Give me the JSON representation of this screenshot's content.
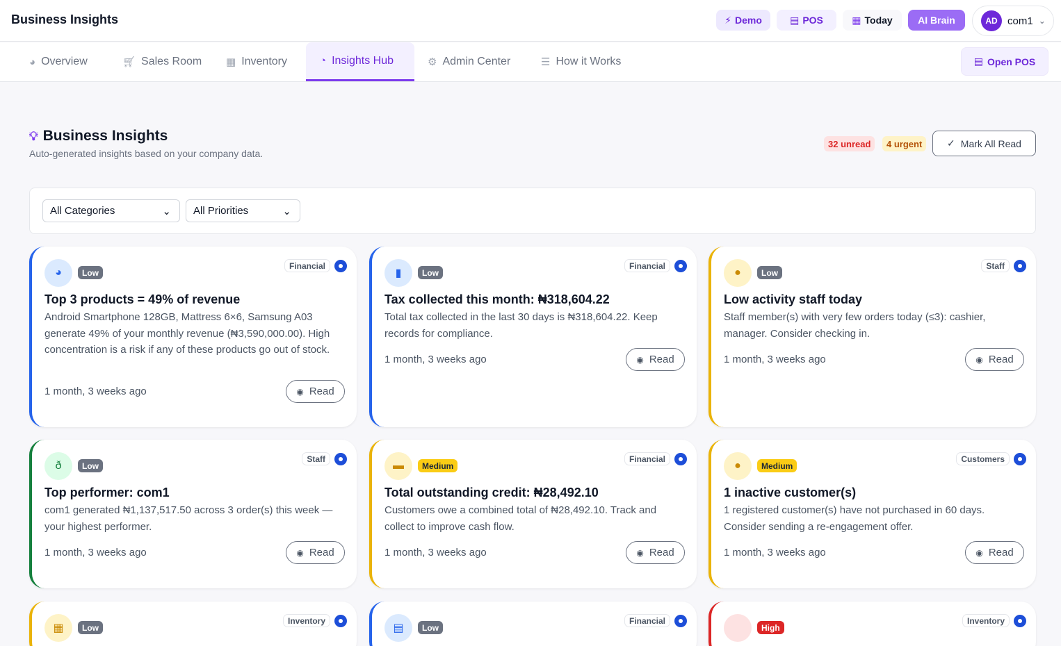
{
  "app": {
    "title": "Business Insights",
    "user_initials": "AD",
    "user_name": "com1"
  },
  "topbar": {
    "demo": "Demo",
    "pos": "POS",
    "today": "Today",
    "ai_brain": "AI Brain"
  },
  "nav": {
    "tabs": [
      {
        "label": "Overview",
        "icon": "dashboard-icon"
      },
      {
        "label": "Sales Room",
        "icon": "cart-icon"
      },
      {
        "label": "Inventory",
        "icon": "boxes-icon"
      },
      {
        "label": "Insights Hub",
        "icon": "pie-chart-icon"
      },
      {
        "label": "Admin Center",
        "icon": "gear-icon"
      },
      {
        "label": "How it Works",
        "icon": "signpost-icon"
      }
    ],
    "active_tab": "Insights Hub",
    "open_pos": "Open POS"
  },
  "header": {
    "title": "Business Insights",
    "subtitle": "Auto-generated insights based on your company data.",
    "unread": "32 unread",
    "urgent": "4 urgent",
    "mark_all": "Mark All Read"
  },
  "filters": {
    "category": "All Categories",
    "priority": "All Priorities"
  },
  "cards": [
    {
      "priority": "Low",
      "category": "Financial",
      "icon": "pie-chart-icon",
      "title": "Top 3 products = 49% of revenue",
      "body": "Android Smartphone 128GB, Mattress 6×6, Samsung A03 generate 49% of your monthly revenue (₦3,590,000.00). High concentration is a risk if any of these products go out of stock.",
      "time": "1 month, 3 weeks ago",
      "read": "Read"
    },
    {
      "priority": "Low",
      "category": "Financial",
      "icon": "invoice-icon",
      "title": "Tax collected this month: ₦318,604.22",
      "body": "Total tax collected in the last 30 days is ₦318,604.22. Keep records for compliance.",
      "time": "1 month, 3 weeks ago",
      "read": "Read"
    },
    {
      "priority": "Low",
      "category": "Staff",
      "icon": "user-icon",
      "title": "Low activity staff today",
      "body": "Staff member(s) with very few orders today (≤3): cashier, manager. Consider checking in.",
      "time": "1 month, 3 weeks ago",
      "read": "Read"
    },
    {
      "priority": "Low",
      "category": "Staff",
      "icon": "medal-icon",
      "title": "Top performer: com1",
      "body": "com1 generated ₦1,137,517.50 across 3 order(s) this week — your highest performer.",
      "time": "1 month, 3 weeks ago",
      "read": "Read"
    },
    {
      "priority": "Medium",
      "category": "Financial",
      "icon": "money-icon",
      "title": "Total outstanding credit: ₦28,492.10",
      "body": "Customers owe a combined total of ₦28,492.10. Track and collect to improve cash flow.",
      "time": "1 month, 3 weeks ago",
      "read": "Read"
    },
    {
      "priority": "Medium",
      "category": "Customers",
      "icon": "user-clock-icon",
      "title": "1 inactive customer(s)",
      "body": "1 registered customer(s) have not purchased in 60 days. Consider sending a re-engagement offer.",
      "time": "1 month, 3 weeks ago",
      "read": "Read"
    },
    {
      "priority": "Low",
      "category": "Inventory",
      "icon": "boxes-icon",
      "title": "",
      "body": "",
      "time": "",
      "read": ""
    },
    {
      "priority": "Low",
      "category": "Financial",
      "icon": "warehouse-icon",
      "title": "",
      "body": "",
      "time": "",
      "read": ""
    },
    {
      "priority": "High",
      "category": "Inventory",
      "icon": "alert-icon",
      "title": "",
      "body": "",
      "time": "",
      "read": ""
    }
  ],
  "colors": {
    "accent": "#7c3aed",
    "blue": "#2563eb",
    "yellow": "#facc15",
    "green": "#15803d",
    "red": "#dc2626"
  }
}
